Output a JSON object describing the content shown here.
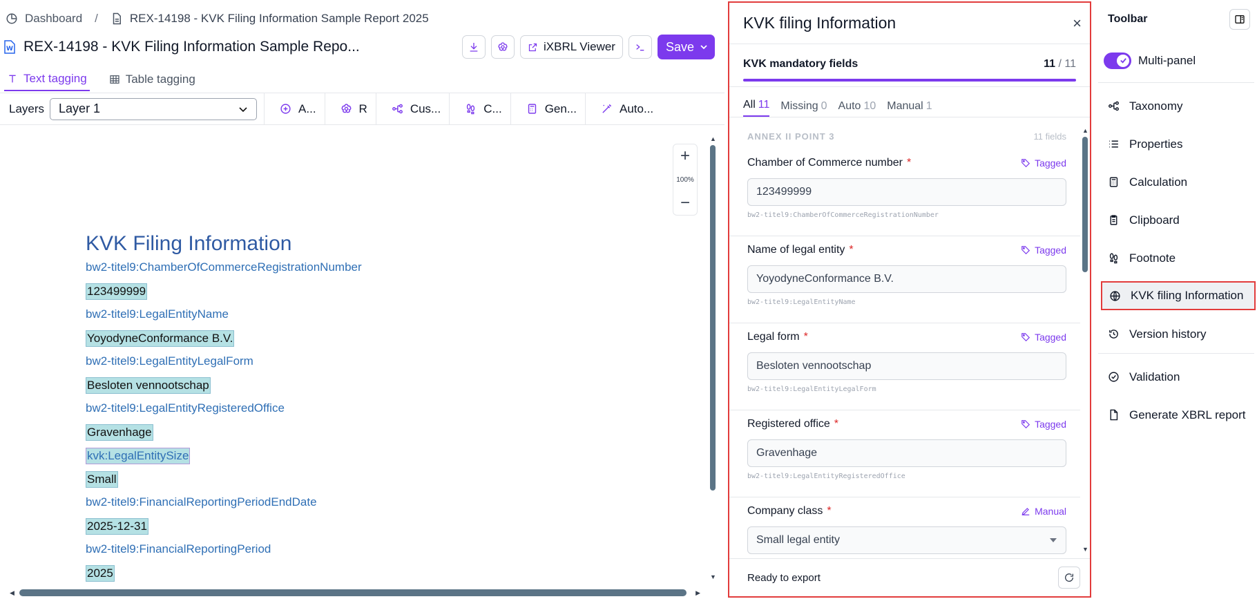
{
  "breadcrumb": {
    "home": "Dashboard",
    "separator": "/",
    "current": "REX-14198 - KVK Filing Information Sample Report 2025"
  },
  "header": {
    "title": "REX-14198 - KVK Filing Information Sample Repo...",
    "viewer_label": "iXBRL Viewer",
    "save_label": "Save"
  },
  "mode_tabs": [
    {
      "label": "Text tagging",
      "active": true
    },
    {
      "label": "Table tagging",
      "active": false
    }
  ],
  "toolbar_row": {
    "layers_label": "Layers",
    "layer_value": "Layer 1",
    "tools": [
      {
        "label": "A...",
        "icon": "plus-circle-icon"
      },
      {
        "label": "R",
        "icon": "flower-icon"
      },
      {
        "label": "Cus...",
        "icon": "hierarchy-icon"
      },
      {
        "label": "C...",
        "icon": "footprint-icon"
      },
      {
        "label": "Gen...",
        "icon": "calculator-icon"
      },
      {
        "label": "Auto...",
        "icon": "magic-wand-icon"
      }
    ]
  },
  "zoom": {
    "plus": "+",
    "level": "100%",
    "minus": "−"
  },
  "document": {
    "title": "KVK Filing Information",
    "lines": [
      {
        "text": "bw2-titel9:ChamberOfCommerceRegistrationNumber",
        "kind": "label"
      },
      {
        "text": "123499999",
        "kind": "value"
      },
      {
        "text": "bw2-titel9:LegalEntityName",
        "kind": "label"
      },
      {
        "text": "YoyodyneConformance B.V.",
        "kind": "value"
      },
      {
        "text": "bw2-titel9:LegalEntityLegalForm",
        "kind": "label"
      },
      {
        "text": "Besloten vennootschap",
        "kind": "value"
      },
      {
        "text": "bw2-titel9:LegalEntityRegisteredOffice",
        "kind": "label"
      },
      {
        "text": "Gravenhage",
        "kind": "value"
      },
      {
        "text": "kvk:LegalEntitySize",
        "kind": "tagged-label"
      },
      {
        "text": "Small",
        "kind": "value"
      },
      {
        "text": "bw2-titel9:FinancialReportingPeriodEndDate",
        "kind": "label"
      },
      {
        "text": "2025-12-31",
        "kind": "value"
      },
      {
        "text": "bw2-titel9:FinancialReportingPeriod",
        "kind": "label"
      },
      {
        "text": "2025",
        "kind": "value"
      }
    ]
  },
  "kvk_panel": {
    "title": "KVK filing Information",
    "close": "×",
    "mandatory_label": "KVK mandatory fields",
    "mandatory_done": "11",
    "mandatory_total": "/ 11",
    "mandatory_progress": 1.0,
    "filter_tabs": [
      {
        "label": "All",
        "count": "11",
        "active": true
      },
      {
        "label": "Missing",
        "count": "0",
        "active": false
      },
      {
        "label": "Auto",
        "count": "10",
        "active": false
      },
      {
        "label": "Manual",
        "count": "1",
        "active": false
      }
    ],
    "section": {
      "title": "ANNEX II POINT 3",
      "count": "11 fields"
    },
    "fields": [
      {
        "label": "Chamber of Commerce number",
        "req": "*",
        "status": "Tagged",
        "value": "123499999",
        "qname": "bw2-titel9:ChamberOfCommerceRegistrationNumber"
      },
      {
        "label": "Name of legal entity",
        "req": "*",
        "status": "Tagged",
        "value": "YoyodyneConformance B.V.",
        "qname": "bw2-titel9:LegalEntityName"
      },
      {
        "label": "Legal form",
        "req": "*",
        "status": "Tagged",
        "value": "Besloten vennootschap",
        "qname": "bw2-titel9:LegalEntityLegalForm"
      },
      {
        "label": "Registered office",
        "req": "*",
        "status": "Tagged",
        "value": "Gravenhage",
        "qname": "bw2-titel9:LegalEntityRegisteredOffice"
      },
      {
        "label": "Company class",
        "req": "*",
        "status": "Manual",
        "value": "Small legal entity",
        "qname": ""
      }
    ],
    "footer_status": "Ready to export"
  },
  "toolbar": {
    "title": "Toolbar",
    "multipanel_label": "Multi-panel",
    "multipanel_on": true,
    "group1": [
      {
        "label": "Taxonomy",
        "icon": "hierarchy-icon"
      },
      {
        "label": "Properties",
        "icon": "list-icon"
      },
      {
        "label": "Calculation",
        "icon": "calculator-icon"
      },
      {
        "label": "Clipboard",
        "icon": "clipboard-icon"
      },
      {
        "label": "Footnote",
        "icon": "footprint-icon"
      },
      {
        "label": "KVK filing Information",
        "icon": "globe-icon",
        "active": true
      },
      {
        "label": "Version history",
        "icon": "history-icon"
      }
    ],
    "group2": [
      {
        "label": "Validation",
        "icon": "check-circle-icon"
      },
      {
        "label": "Generate XBRL report",
        "icon": "document-icon"
      }
    ]
  },
  "colors": {
    "accent": "#7c3aed",
    "highlight_border": "#e23b3b",
    "tag_fill": "#b5e1e4",
    "doc_label": "#2f6fb5"
  }
}
